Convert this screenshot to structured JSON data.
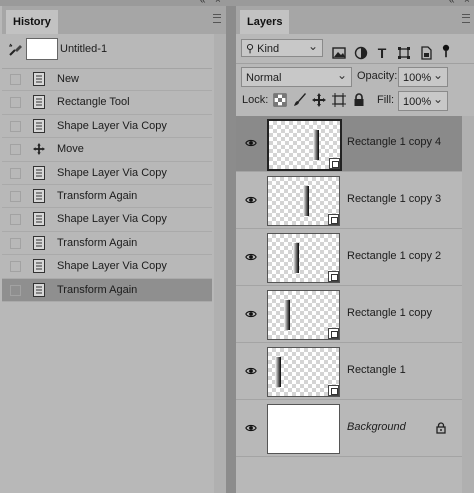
{
  "history": {
    "tab": "History",
    "snapshot": "Untitled-1",
    "items": [
      {
        "label": "New",
        "selected": false
      },
      {
        "label": "Rectangle Tool",
        "selected": false
      },
      {
        "label": "Shape Layer Via Copy",
        "selected": false
      },
      {
        "label": "Move",
        "selected": false
      },
      {
        "label": "Shape Layer Via Copy",
        "selected": false
      },
      {
        "label": "Transform Again",
        "selected": false
      },
      {
        "label": "Shape Layer Via Copy",
        "selected": false
      },
      {
        "label": "Transform Again",
        "selected": false
      },
      {
        "label": "Shape Layer Via Copy",
        "selected": false
      },
      {
        "label": "Transform Again",
        "selected": true
      }
    ]
  },
  "layers": {
    "tab": "Layers",
    "filter": "Kind",
    "blend": "Normal",
    "opacity_label": "Opacity:",
    "opacity": "100%",
    "lock_label": "Lock:",
    "fill_label": "Fill:",
    "fill": "100%",
    "items": [
      {
        "name": "Rectangle 1 copy 4",
        "selected": true,
        "italic": false
      },
      {
        "name": "Rectangle 1 copy 3",
        "selected": false,
        "italic": false
      },
      {
        "name": "Rectangle 1 copy 2",
        "selected": false,
        "italic": false
      },
      {
        "name": "Rectangle 1 copy",
        "selected": false,
        "italic": false
      },
      {
        "name": "Rectangle 1",
        "selected": false,
        "italic": false
      },
      {
        "name": "Background",
        "selected": false,
        "italic": true
      }
    ]
  },
  "colors": {
    "panel": "#b8b8b8",
    "selected_row": "#8f8f8f",
    "divider": "#8c8c8c"
  },
  "icons": [
    "collapse-icon",
    "close-icon",
    "panel-menu-icon",
    "history-brush-icon",
    "document-icon",
    "move-icon",
    "search-icon",
    "image-filter-icon",
    "adjustment-filter-icon",
    "type-filter-icon",
    "shape-filter-icon",
    "smart-object-filter-icon",
    "filter-toggle-icon",
    "lock-transparent-icon",
    "lock-paint-icon",
    "lock-position-icon",
    "lock-artboard-icon",
    "lock-all-icon",
    "eye-icon",
    "lock-icon"
  ]
}
